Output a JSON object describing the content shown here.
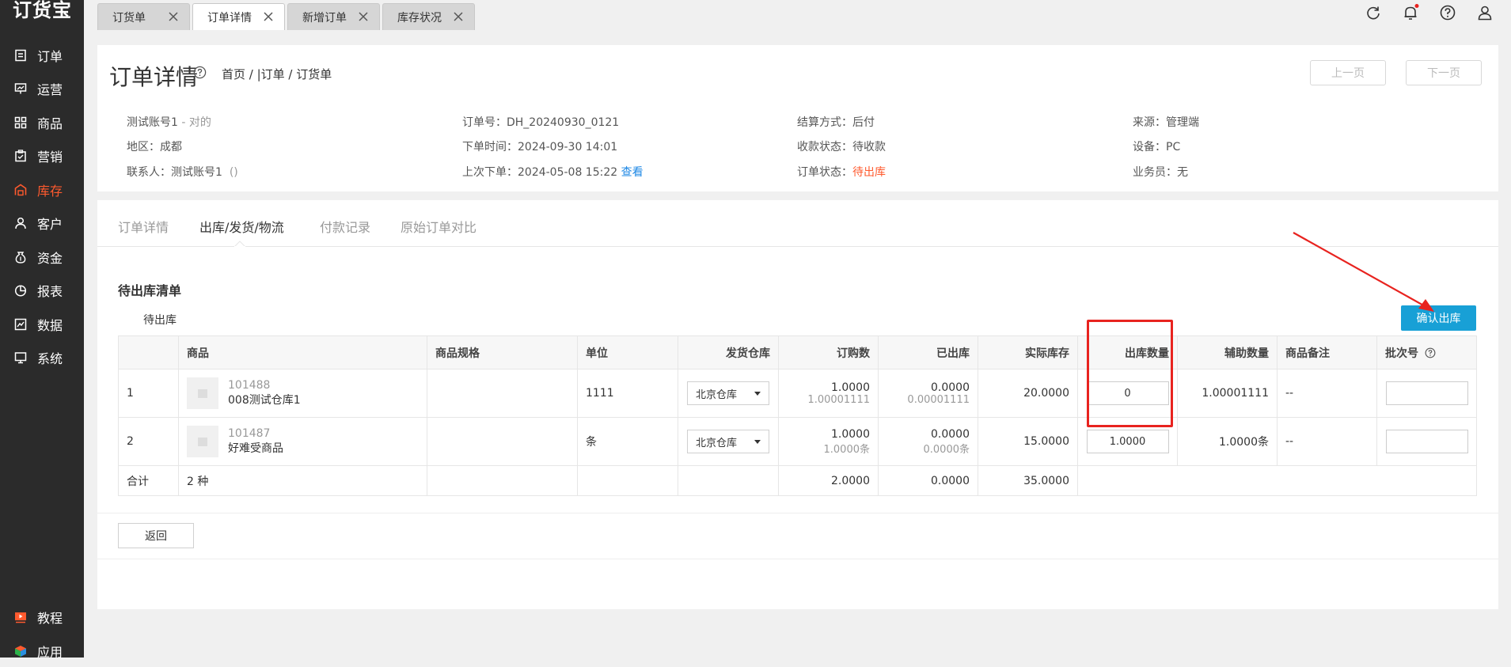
{
  "app": {
    "logo": "订货宝"
  },
  "sidebar": {
    "items": [
      {
        "label": "订单",
        "icon": "order-icon"
      },
      {
        "label": "运营",
        "icon": "operation-icon"
      },
      {
        "label": "商品",
        "icon": "product-icon"
      },
      {
        "label": "营销",
        "icon": "marketing-icon"
      },
      {
        "label": "库存",
        "icon": "inventory-icon",
        "active": true
      },
      {
        "label": "客户",
        "icon": "customer-icon"
      },
      {
        "label": "资金",
        "icon": "funds-icon"
      },
      {
        "label": "报表",
        "icon": "report-icon"
      },
      {
        "label": "数据",
        "icon": "data-icon"
      },
      {
        "label": "系统",
        "icon": "system-icon"
      }
    ],
    "bottom": [
      {
        "label": "教程",
        "icon": "tutorial-icon"
      },
      {
        "label": "应用",
        "icon": "apps-icon"
      }
    ]
  },
  "tabs": [
    {
      "label": "订货单",
      "active": false
    },
    {
      "label": "订单详情",
      "active": true
    },
    {
      "label": "新增订单",
      "active": false
    },
    {
      "label": "库存状况",
      "active": false
    }
  ],
  "header": {
    "title": "订单详情",
    "breadcrumb": "首页 / |订单 / 订货单",
    "prev": "上一页",
    "next": "下一页"
  },
  "info": {
    "account_name": "测试账号1",
    "account_suffix": " - 对的",
    "region_label": "地区：",
    "region": "成都",
    "contact_label": "联系人：",
    "contact": "测试账号1",
    "contact_paren": "()",
    "order_no_label": "订单号：",
    "order_no": "DH_20240930_0121",
    "order_time_label": "下单时间：",
    "order_time": "2024-09-30 14:01",
    "last_order_label": "上次下单：",
    "last_order": "2024-05-08 15:22",
    "last_order_link": "查看",
    "settle_label": "结算方式：",
    "settle": "后付",
    "pay_status_label": "收款状态：",
    "pay_status": "待收款",
    "order_status_label": "订单状态：",
    "order_status": "待出库",
    "source_label": "来源：",
    "source": "管理端",
    "device_label": "设备：",
    "device": "PC",
    "salesman_label": "业务员：",
    "salesman": "无"
  },
  "detail_tabs": [
    "订单详情",
    "出库/发货/物流",
    "付款记录",
    "原始订单对比"
  ],
  "section": {
    "title": "待出库清单",
    "sub_label": "待出库",
    "confirm_button": "确认出库"
  },
  "table": {
    "headers": [
      "",
      "商品",
      "商品规格",
      "单位",
      "发货仓库",
      "订购数",
      "已出库",
      "实际库存",
      "出库数量",
      "辅助数量",
      "商品备注",
      "批次号"
    ],
    "rows": [
      {
        "no": "1",
        "code": "101488",
        "name": "008测试仓库1",
        "spec": "",
        "unit": "1111",
        "warehouse": "北京仓库",
        "ordered": "1.0000",
        "ordered_sub": "1.00001111",
        "shipped": "0.0000",
        "shipped_sub": "0.00001111",
        "stock": "20.0000",
        "out_qty": "0",
        "aux_qty": "1.00001111",
        "remark": "--",
        "batch": ""
      },
      {
        "no": "2",
        "code": "101487",
        "name": "好难受商品",
        "spec": "",
        "unit": "条",
        "warehouse": "北京仓库",
        "ordered": "1.0000",
        "ordered_sub": "1.0000条",
        "shipped": "0.0000",
        "shipped_sub": "0.0000条",
        "stock": "15.0000",
        "out_qty": "1.0000",
        "aux_qty": "1.0000条",
        "remark": "--",
        "batch": ""
      }
    ],
    "total": {
      "label": "合计",
      "kinds": "2 种",
      "ordered": "2.0000",
      "shipped": "0.0000",
      "stock": "35.0000"
    }
  },
  "back_button": "返回",
  "colors": {
    "accent": "#ff5a2e",
    "primary": "#18a0d6",
    "annotation": "#e8231f"
  }
}
